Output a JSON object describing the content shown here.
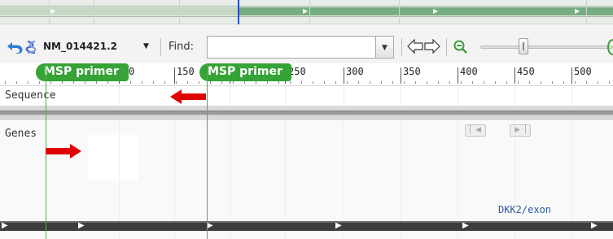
{
  "toolbar": {
    "accession": "NM_014421.2",
    "find_label": "Find:",
    "find_value": "",
    "find_placeholder": ""
  },
  "ruler": {
    "ticks": [
      "0",
      "150",
      "250",
      "300",
      "350",
      "400",
      "450",
      "500"
    ]
  },
  "primers": [
    {
      "label": "MSP primer"
    },
    {
      "label": "MSP primer"
    }
  ],
  "tracks": {
    "sequence": "Sequence",
    "genes": "Genes"
  },
  "gene_feature": {
    "label": "DKK2/exon"
  },
  "colors": {
    "primer": "#35a335",
    "arrow": "#e00000",
    "overview_band": "#76ad80",
    "overview_marker": "#2c4fb8",
    "exon_label": "#2f5aa8"
  },
  "icons": [
    "undo-icon",
    "sequence-icon",
    "nav-left-icon",
    "nav-right-icon",
    "zoom-out-icon",
    "zoom-in-icon",
    "pager-prev-icon",
    "pager-next-icon"
  ]
}
